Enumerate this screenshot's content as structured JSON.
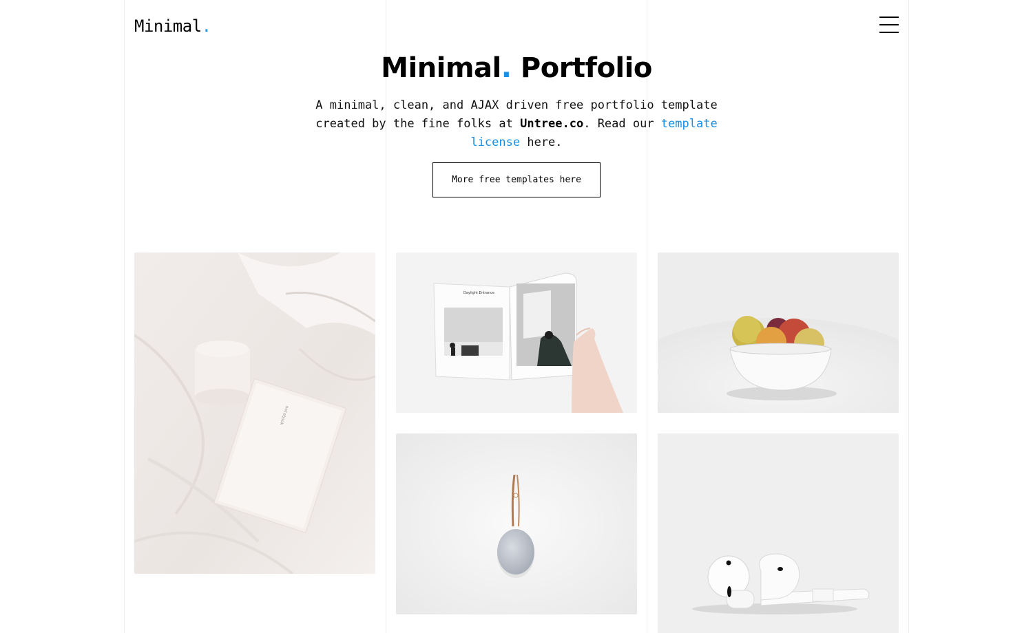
{
  "header": {
    "logo_text": "Minimal",
    "logo_dot": ".",
    "menu_icon": "hamburger-menu-icon"
  },
  "hero": {
    "title_word1": "Minimal",
    "title_dot": ".",
    "title_word2": " Portfolio",
    "description_part1": "A minimal, clean, and AJAX driven free portfolio template created by the fine folks at ",
    "description_brand": "Untree.co",
    "description_part2": ". Read our ",
    "description_link": "template license",
    "description_part3": " here.",
    "button_label": "More free templates here"
  },
  "portfolio": {
    "items": [
      {
        "subject": "bed with notebook and candle jar"
      },
      {
        "subject": "open magazine held by hand"
      },
      {
        "subject": "bowl of fruit"
      },
      {
        "subject": "hanging round speaker"
      },
      {
        "subject": "white earbuds"
      }
    ]
  },
  "colors": {
    "accent": "#1a8fe3",
    "text": "#000000",
    "background": "#ffffff",
    "grid_line": "#ececec"
  }
}
